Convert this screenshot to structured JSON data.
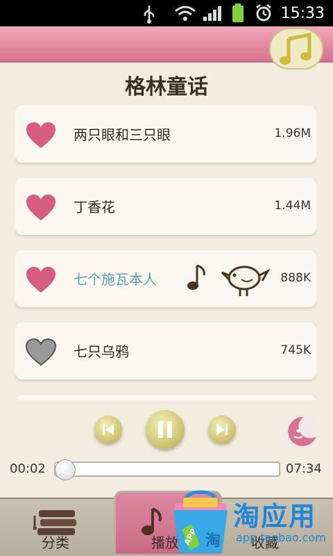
{
  "status_bar": {
    "time": "15:33",
    "icons": [
      "usb-icon",
      "wifi-icon",
      "signal-icon",
      "battery-icon",
      "alarm-icon"
    ]
  },
  "header": {
    "title": "格林童话",
    "badge_icon": "music-note-icon"
  },
  "stories": [
    {
      "title": "两只眼和三只眼",
      "size": "1.96M",
      "favorite": true
    },
    {
      "title": "丁香花",
      "size": "1.44M",
      "favorite": true
    },
    {
      "title": "七个施瓦本人",
      "size": "888K",
      "favorite": true,
      "playing": true
    },
    {
      "title": "七只乌鸦",
      "size": "745K",
      "favorite": false
    }
  ],
  "player": {
    "elapsed": "00:02",
    "total": "07:34",
    "progress": 0.004,
    "controls": [
      "previous-icon",
      "pause-icon",
      "next-icon"
    ]
  },
  "tabs": [
    {
      "label": "分类",
      "icon": "books-icon",
      "active": false
    },
    {
      "label": "播放",
      "icon": "music-note-icon",
      "active": true
    },
    {
      "label": "收藏",
      "icon": "heart-icon",
      "active": false
    }
  ],
  "watermark": {
    "title": "淘应用",
    "url": "app.taobao.com",
    "tag": "APP",
    "glyph": "淘"
  },
  "colors": {
    "pink": "#d6738f",
    "heart": "#d85c80",
    "gray_heart": "#6f6f6f",
    "playing_text": "#5aa3a8",
    "control": "#c9c06a"
  }
}
